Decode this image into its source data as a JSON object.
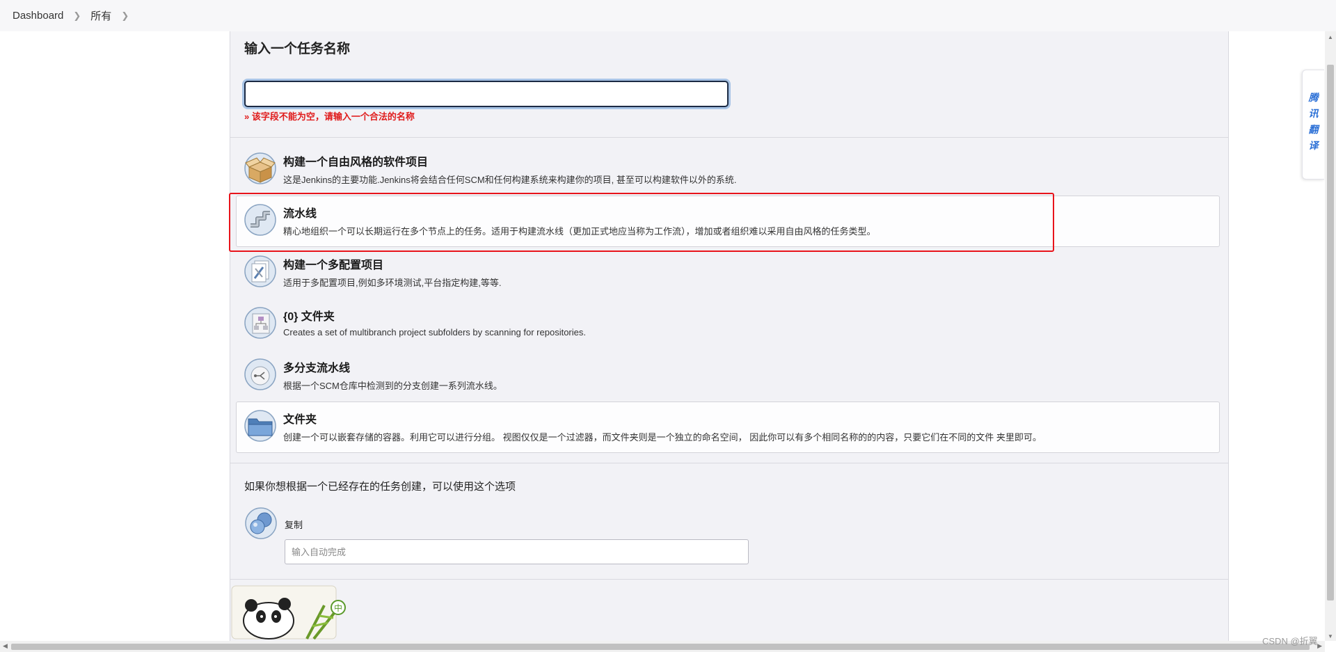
{
  "breadcrumb": {
    "items": [
      "Dashboard",
      "所有"
    ]
  },
  "name_section": {
    "heading": "输入一个任务名称",
    "input_value": "",
    "error": "» 该字段不能为空，请输入一个合法的名称"
  },
  "job_types": [
    {
      "title": "构建一个自由风格的软件项目",
      "desc": "这是Jenkins的主要功能.Jenkins将会结合任何SCM和任何构建系统来构建你的项目, 甚至可以构建软件以外的系统.",
      "icon": "freestyle-box-icon"
    },
    {
      "title": "流水线",
      "desc": "精心地组织一个可以长期运行在多个节点上的任务。适用于构建流水线（更加正式地应当称为工作流），增加或者组织难以采用自由风格的任务类型。",
      "icon": "pipeline-icon"
    },
    {
      "title": "构建一个多配置项目",
      "desc": "适用于多配置项目,例如多环境测试,平台指定构建,等等.",
      "icon": "multi-config-icon"
    },
    {
      "title": "{0} 文件夹",
      "desc": "Creates a set of multibranch project subfolders by scanning for repositories.",
      "icon": "org-folder-icon"
    },
    {
      "title": "多分支流水线",
      "desc": "根据一个SCM仓库中检测到的分支创建一系列流水线。",
      "icon": "multibranch-pipeline-icon"
    },
    {
      "title": "文件夹",
      "desc": "创建一个可以嵌套存储的容器。利用它可以进行分组。 视图仅仅是一个过滤器，而文件夹则是一个独立的命名空间， 因此你可以有多个相同名称的的内容，只要它们在不同的文件 夹里即可。",
      "icon": "folder-icon"
    }
  ],
  "copy_section": {
    "question": "如果你想根据一个已经存在的任务创建，可以使用这个选项",
    "label": "复制",
    "placeholder": "输入自动完成"
  },
  "translate_tab": {
    "chars": [
      "腾",
      "讯",
      "翻",
      "译"
    ]
  },
  "watermark": "CSDN @折翼",
  "colors": {
    "accent_error": "#e01b1b",
    "highlight": "#e8141b",
    "panel_bg": "#f2f2f6",
    "link_blue": "#2a6fd6"
  }
}
